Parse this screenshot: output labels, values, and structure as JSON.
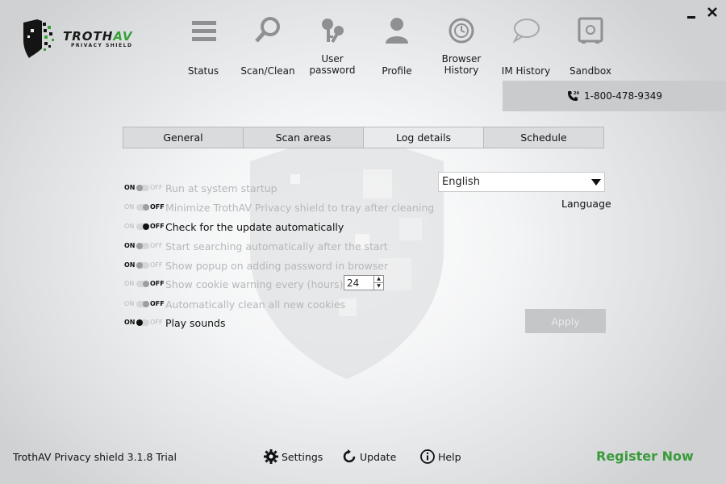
{
  "app": {
    "logo_name": "TROTH",
    "logo_suffix": "AV",
    "logo_tagline": "PRIVACY SHIELD"
  },
  "window": {
    "minimize_icon": "minimize-icon",
    "close_icon": "close-icon"
  },
  "nav": [
    {
      "id": "status",
      "label": "Status",
      "icon": "list-icon"
    },
    {
      "id": "scan-clean",
      "label": "Scan/Clean",
      "icon": "magnifier-icon"
    },
    {
      "id": "user-password",
      "label": "User password",
      "icon": "keys-icon"
    },
    {
      "id": "profile",
      "label": "Profile",
      "icon": "user-icon"
    },
    {
      "id": "browser-history",
      "label": "Browser History",
      "icon": "history-icon"
    },
    {
      "id": "im-history",
      "label": "IM History",
      "icon": "chat-bubble-icon"
    },
    {
      "id": "sandbox",
      "label": "Sandbox",
      "icon": "safe-icon"
    }
  ],
  "phone": "1-800-478-9349",
  "tabs": [
    {
      "label": "General",
      "active": false
    },
    {
      "label": "Scan areas",
      "active": false
    },
    {
      "label": "Log details",
      "active": true
    },
    {
      "label": "Schedule",
      "active": false
    }
  ],
  "toggle_text": {
    "on": "ON",
    "off": "OFF"
  },
  "options": [
    {
      "label": "Run at system startup",
      "state": "on",
      "enabled": false
    },
    {
      "label": "Minimize TrothAV Privacy shield to tray after cleaning",
      "state": "off",
      "enabled": false
    },
    {
      "label": "Check for the update automatically",
      "state": "off",
      "enabled": true
    },
    {
      "label": "Start searching automatically after the start",
      "state": "on",
      "enabled": false
    },
    {
      "label": "Show popup on adding password in browser",
      "state": "on",
      "enabled": false
    },
    {
      "label": "Show cookie warning every (hours):",
      "state": "off",
      "enabled": false
    },
    {
      "label": "Automatically clean all new cookies",
      "state": "off",
      "enabled": false
    },
    {
      "label": "Play sounds",
      "state": "on",
      "enabled": true
    }
  ],
  "cookie_hours": "24",
  "language": {
    "value": "English",
    "label": "Language"
  },
  "apply_label": "Apply",
  "footer": {
    "version": "TrothAV Privacy shield 3.1.8 Trial",
    "settings": "Settings",
    "update": "Update",
    "help": "Help",
    "register": "Register Now"
  },
  "colors": {
    "accent_green": "#3a9b3a",
    "logo_green": "#3aa13a"
  }
}
